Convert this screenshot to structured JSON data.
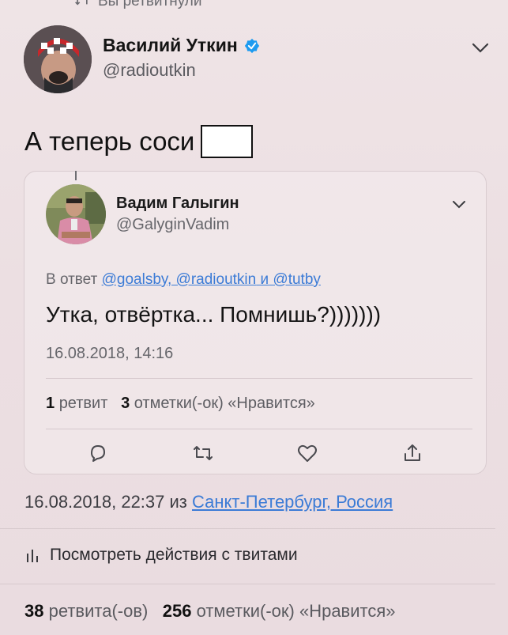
{
  "header": {
    "retweeted_label": "Вы ретвитнули"
  },
  "author": {
    "name": "Василий Уткин",
    "handle": "@radioutkin",
    "verified": true
  },
  "tweet": {
    "text": "А теперь соси"
  },
  "quoted": {
    "name": "Вадим Галыгин",
    "handle": "@GalyginVadim",
    "reply_prefix": "В ответ",
    "reply_to_links": "@goalsby, @radioutkin",
    "reply_and": "и",
    "reply_to_last": "@tutby",
    "text": "Утка, отвёртка... Помнишь?)))))))",
    "date": "16.08.2018, 14:16",
    "retweets_count": "1",
    "retweets_label": "ретвит",
    "likes_count": "3",
    "likes_label": "отметки(-ок) «Нравится»",
    "actions": [
      "reply",
      "retweet",
      "like",
      "share"
    ]
  },
  "meta": {
    "date_prefix": "16.08.2018, 22:37 из",
    "location": "Санкт-Петербург, Россия",
    "activity_label": "Посмотреть действия с твитами",
    "retweets_count": "38",
    "retweets_label": "ретвита(-ов)",
    "likes_count": "256",
    "likes_label": "отметки(-ок) «Нравится»"
  },
  "colors": {
    "background": "#ecdfe2",
    "link": "#3b7bd6",
    "verified": "#1d9bf0",
    "secondary_text": "#66666b"
  }
}
